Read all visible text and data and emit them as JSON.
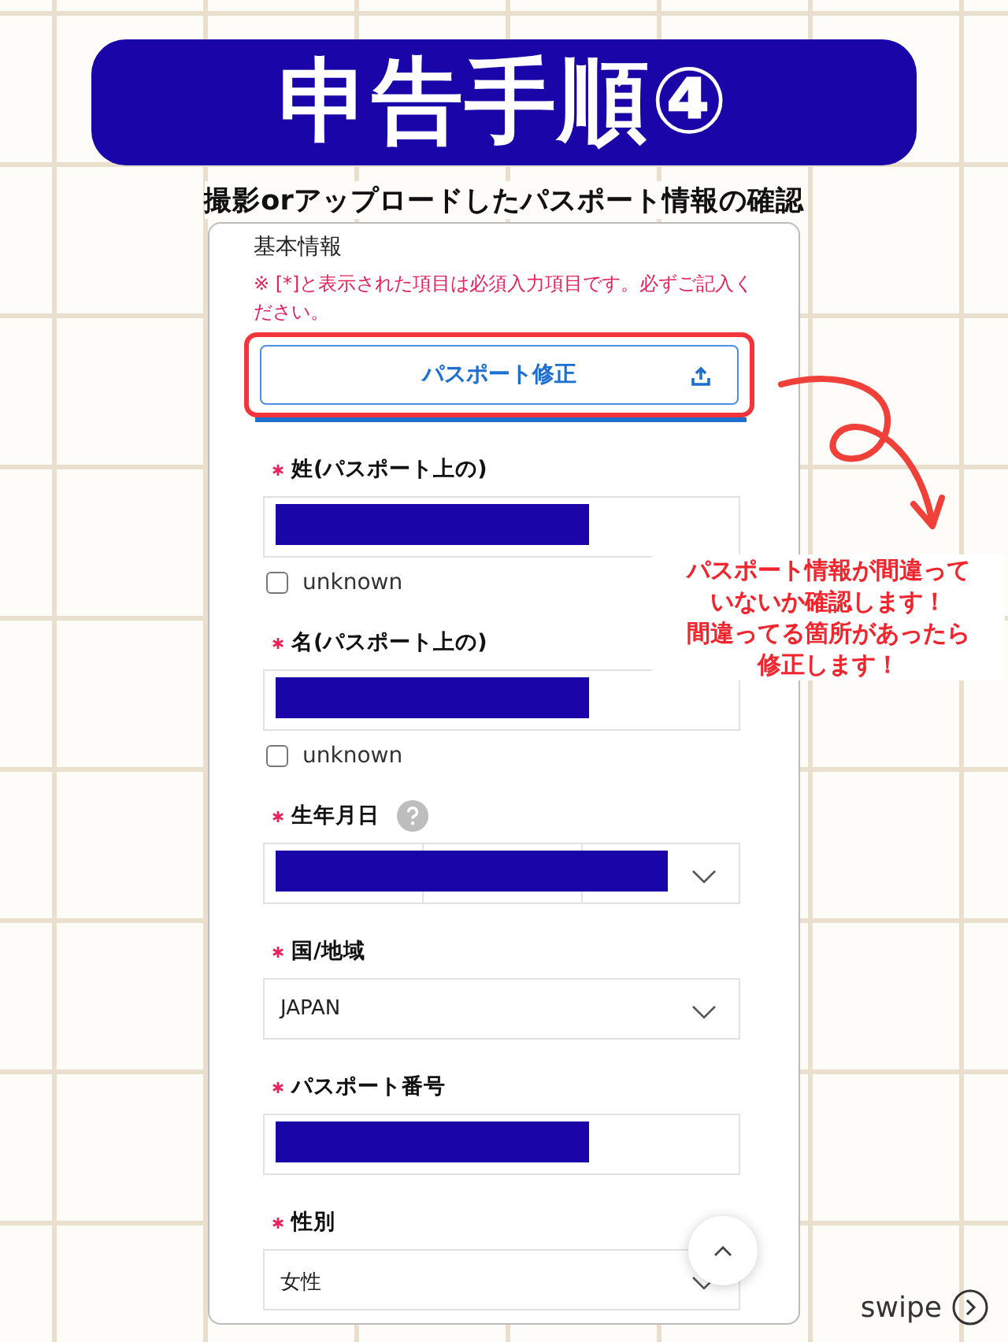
{
  "title": "申告手順④",
  "subtitle": "撮影orアップロードしたパスポート情報の確認",
  "form": {
    "section_title": "基本情報",
    "notice": "※ [*]と表示された項目は必須入力項目です。必ずご記入ください。",
    "passport_button": {
      "label": "パスポート修正",
      "highlighted": true
    },
    "fields": [
      {
        "label": "姓(パスポート上の)",
        "required": true,
        "help": false,
        "kind": "redacted",
        "unknown": {
          "label": "unknown",
          "checked": false
        }
      },
      {
        "label": "名(パスポート上の)",
        "required": true,
        "help": false,
        "kind": "redacted",
        "unknown": {
          "label": "unknown",
          "checked": false
        }
      },
      {
        "label": "生年月日",
        "required": true,
        "help": true,
        "kind": "redacted_date"
      },
      {
        "label": "国/地域",
        "required": true,
        "help": false,
        "kind": "select",
        "value": "JAPAN"
      },
      {
        "label": "パスポート番号",
        "required": true,
        "help": false,
        "kind": "redacted"
      },
      {
        "label": "性別",
        "required": true,
        "help": false,
        "kind": "select",
        "value": "女性"
      }
    ]
  },
  "callout": [
    "パスポート情報が間違って",
    "いないか確認します！",
    "間違ってる箇所があったら",
    "修正します！"
  ],
  "swipe": "swipe"
}
